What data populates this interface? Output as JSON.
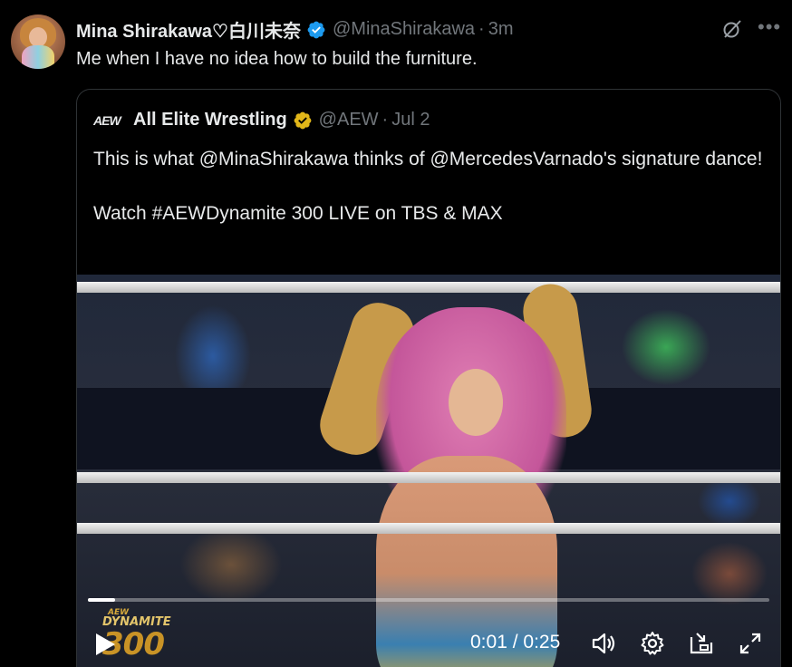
{
  "tweet": {
    "author_name": "Mina Shirakawa♡白川未奈",
    "handle": "@MinaShirakawa",
    "separator": "·",
    "time": "3m",
    "text": "Me when I have no idea how to build the furniture.",
    "icons": {
      "verified": "verified-badge-icon",
      "grok": "grok-icon",
      "more": "more-icon"
    },
    "colors": {
      "verified_blue": "#1d9bf0",
      "muted": "#71767b",
      "text": "#e7e9ea",
      "background": "#000000"
    }
  },
  "quote": {
    "logo_text": "AEW",
    "author_name": "All Elite Wrestling",
    "handle": "@AEW",
    "separator": "·",
    "date": "Jul 2",
    "text_line1": "This is what @MinaShirakawa thinks of @MercedesVarnado's signature dance!",
    "text_line2": "Watch #AEWDynamite 300 LIVE on TBS & MAX",
    "badge_color": "#e2b719"
  },
  "video": {
    "current_time": "0:01",
    "time_separator": "/",
    "duration": "0:25",
    "progress_fraction": 0.04,
    "watermark": {
      "brand": "AEW",
      "show": "DYNAMITE",
      "number": "300"
    },
    "controls": [
      "play-icon",
      "volume-icon",
      "settings-icon",
      "pip-icon",
      "fullscreen-icon"
    ]
  }
}
